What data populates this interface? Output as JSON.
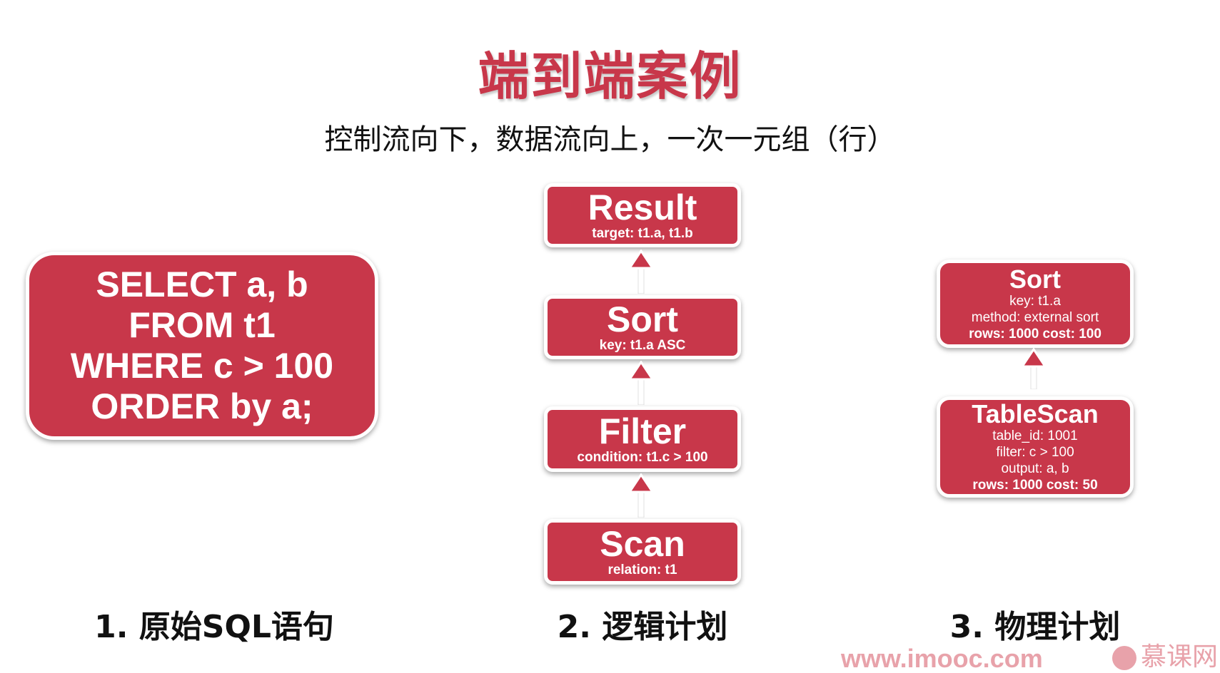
{
  "title": "端到端案例",
  "subtitle": "控制流向下，数据流向上，一次一元组（行）",
  "sql": {
    "lines": [
      "SELECT a, b",
      "FROM t1",
      "WHERE c > 100",
      "ORDER by a;"
    ]
  },
  "logical_plan": {
    "nodes": [
      {
        "name": "Result",
        "detail": "target: t1.a, t1.b"
      },
      {
        "name": "Sort",
        "detail": "key: t1.a ASC"
      },
      {
        "name": "Filter",
        "detail": "condition: t1.c > 100"
      },
      {
        "name": "Scan",
        "detail": "relation: t1"
      }
    ]
  },
  "physical_plan": {
    "nodes": [
      {
        "name": "Sort",
        "lines": [
          "key: t1.a",
          "method: external sort"
        ],
        "stats": "rows: 1000 cost: 100"
      },
      {
        "name": "TableScan",
        "lines": [
          "table_id: 1001",
          "filter: c > 100",
          "output: a, b"
        ],
        "stats": "rows: 1000 cost: 50"
      }
    ]
  },
  "captions": {
    "sql": "1. 原始SQL语句",
    "logical": "2. 逻辑计划",
    "physical": "3. 物理计划"
  },
  "watermark": "www.imooc.com",
  "brand": "慕课网",
  "colors": {
    "accent": "#c8374a",
    "watermark": "#e8a2aa"
  }
}
